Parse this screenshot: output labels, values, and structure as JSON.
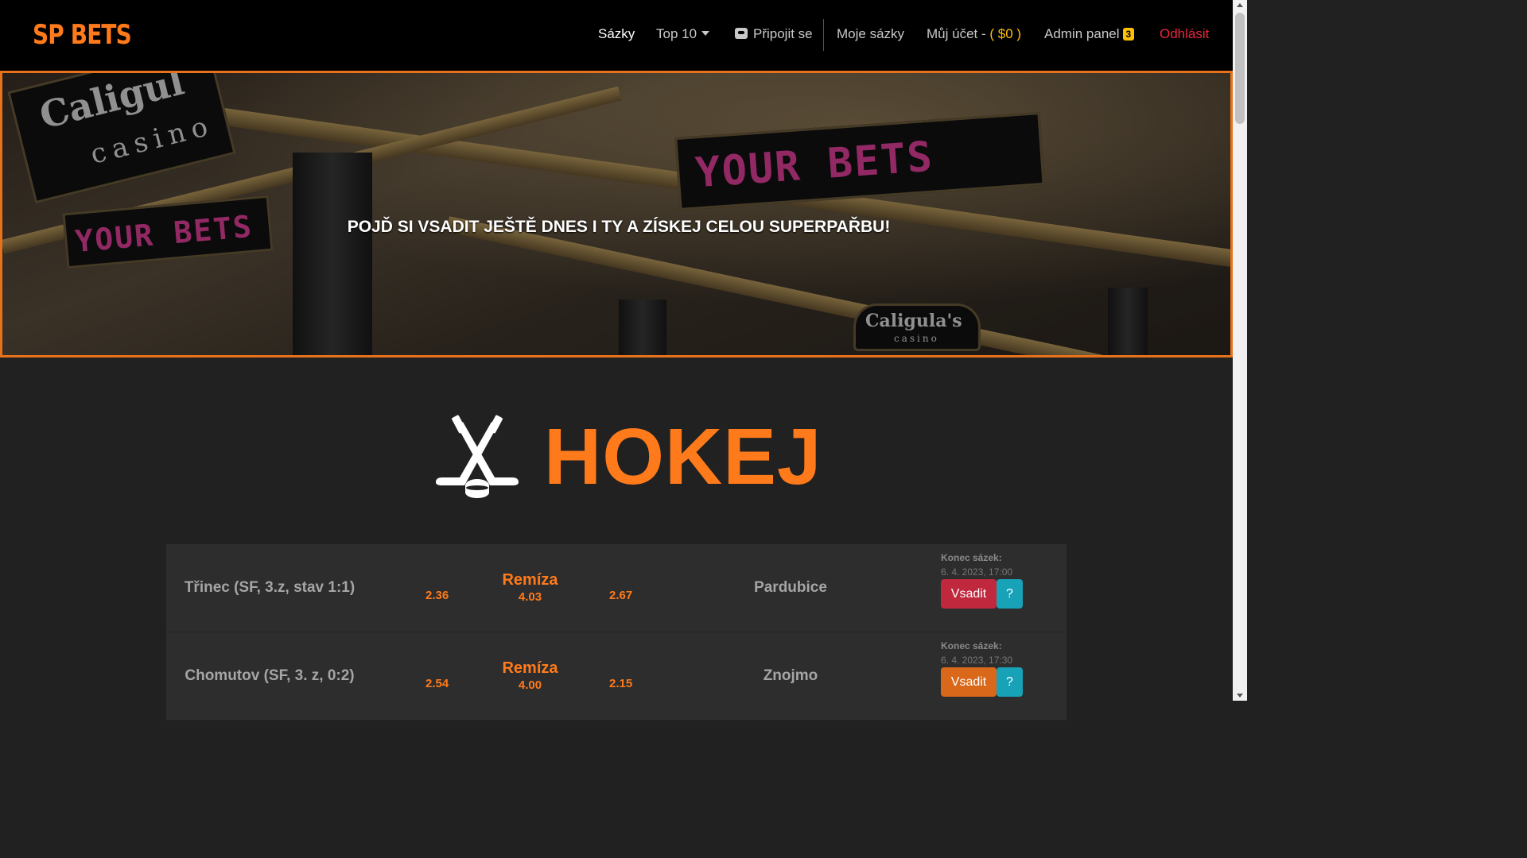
{
  "navbar": {
    "brand": "SP BETS",
    "items": {
      "sazky": "Sázky",
      "top10": "Top 10",
      "join": "Připojit se",
      "my_bets": "Moje sázky",
      "account": "Můj účet - ",
      "balance": "( $0 )",
      "admin": "Admin panel",
      "admin_badge": "3",
      "logout": "Odhlásit"
    }
  },
  "hero": {
    "title": "POJĎ SI VSADIT JEŠTĚ DNES I TY A ZÍSKEJ CELOU SUPERPAŘBU!",
    "signs": [
      "Caligul",
      "casino",
      "YOUR BETS",
      "YOUR BETS",
      "Caligula's",
      "casino"
    ]
  },
  "section": {
    "icon": "hockey-sticks-icon",
    "title": "HOKEJ"
  },
  "matches": [
    {
      "home": "Třinec (SF, 3.z, stav 1:1)",
      "odd_home": "2.36",
      "draw_label": "Remíza",
      "odd_draw": "4.03",
      "odd_away": "2.67",
      "away": "Pardubice",
      "deadline_label": "Konec sázek:",
      "deadline": "6. 4. 2023, 17:00",
      "bet_label": "Vsadit",
      "help_label": "?",
      "bet_color": "#c0283e"
    },
    {
      "home": "Chomutov (SF, 3. z, 0:2)",
      "odd_home": "2.54",
      "draw_label": "Remíza",
      "odd_draw": "4.00",
      "odd_away": "2.15",
      "away": "Znojmo",
      "deadline_label": "Konec sázek:",
      "deadline": "6. 4. 2023, 17:30",
      "bet_label": "Vsadit",
      "help_label": "?",
      "bet_color": "#d9681a"
    }
  ],
  "colors": {
    "accent": "#ff7a1a",
    "logout": "#e8283c",
    "badge": "#ffc107",
    "help": "#17a2b8"
  }
}
